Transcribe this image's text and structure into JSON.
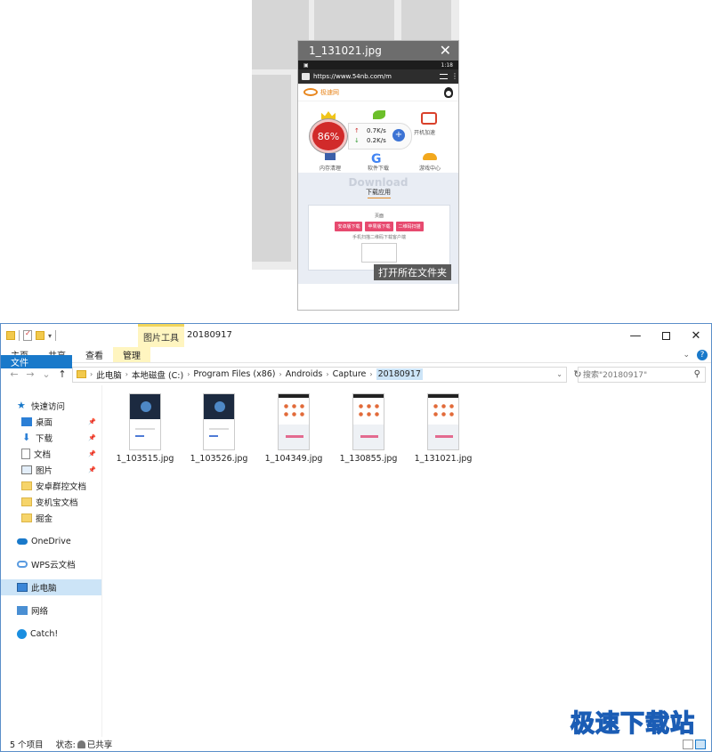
{
  "preview": {
    "title": "1_131021.jpg",
    "close_icon": "close-icon",
    "phone": {
      "url": "https://www.54nb.com/m",
      "time": "1:18",
      "logo_text": "极速网",
      "percent": "86%",
      "upload_speed": "0.7K/s",
      "download_speed": "0.2K/s",
      "labels": [
        "内存清理",
        "软件下载",
        "游戏中心",
        "开机加速",
        "装机必备",
        "手机助手"
      ],
      "download_bg": "Download",
      "download_title": "下载应用",
      "download_sub": "页面",
      "download_buttons": [
        "安卓版下载",
        "苹果版下载",
        "二维码扫描"
      ],
      "download_hint": "手机扫描二维码下载客户端"
    },
    "open_folder_label": "打开所在文件夹"
  },
  "explorer": {
    "context_tab": "图片工具",
    "window_title": "20180917",
    "ribbon_tabs": [
      "文件",
      "主页",
      "共享",
      "查看",
      "管理"
    ],
    "address": [
      "此电脑",
      "本地磁盘 (C:)",
      "Program Files (x86)",
      "Androids",
      "Capture",
      "20180917"
    ],
    "search_placeholder": "搜索\"20180917\"",
    "sidebar": {
      "quick_access": "快速访问",
      "pinned": [
        "桌面",
        "下载",
        "文档",
        "图片"
      ],
      "folders": [
        "安卓群控文档",
        "变机宝文档",
        "掘金"
      ],
      "onedrive": "OneDrive",
      "wps": "WPS云文档",
      "this_pc": "此电脑",
      "network": "网络",
      "catch": "Catch!"
    },
    "files": [
      {
        "name": "1_103515.jpg",
        "style": "dark"
      },
      {
        "name": "1_103526.jpg",
        "style": "dark"
      },
      {
        "name": "1_104349.jpg",
        "style": "light"
      },
      {
        "name": "1_130855.jpg",
        "style": "light"
      },
      {
        "name": "1_131021.jpg",
        "style": "light"
      }
    ],
    "status_count": "5 个项目",
    "status_state_label": "状态:",
    "status_share": "已共享"
  },
  "watermark": "极速下载站",
  "colors": {
    "accent": "#1979ca",
    "context_tab_bg": "#fff5c0",
    "selection": "#cce4f7",
    "preview_title_bg": "#6d6d6d"
  }
}
